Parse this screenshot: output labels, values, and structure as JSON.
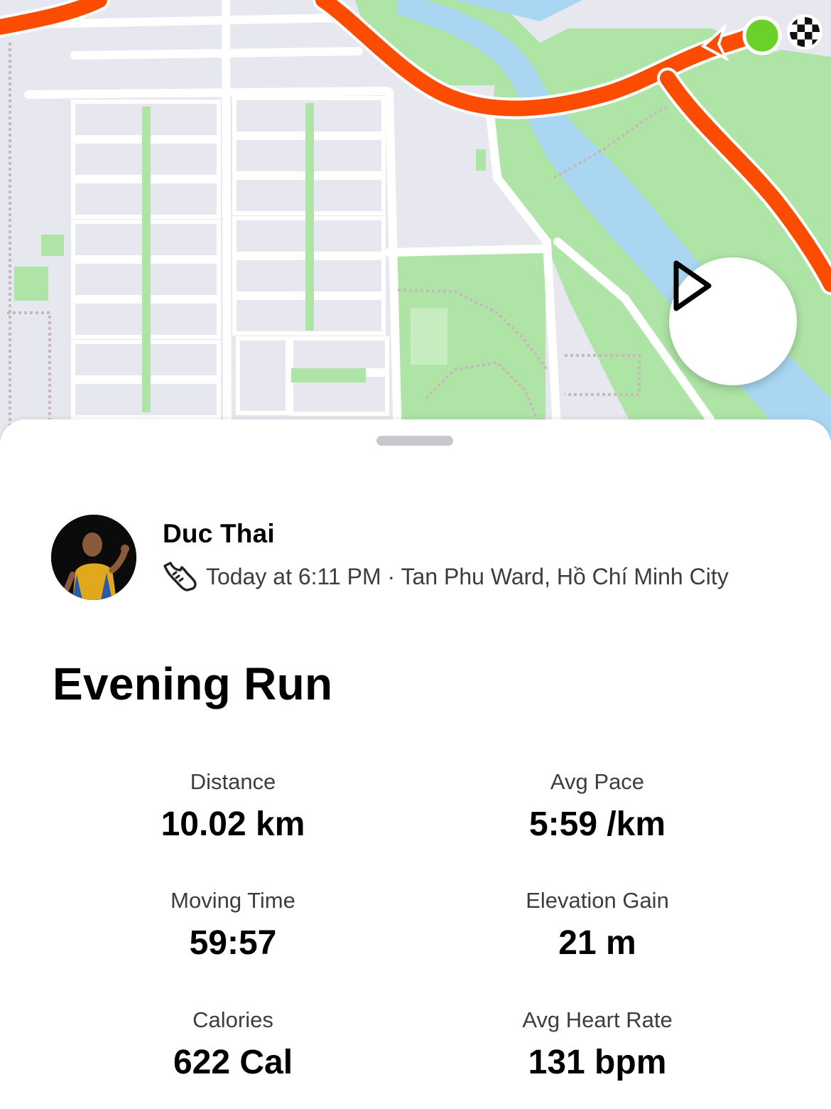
{
  "map": {
    "route_color": "#fc4c02",
    "start_marker_color": "#6ad12a",
    "park_color": "#aee5a6",
    "river_color": "#a9d7f2",
    "land_color": "#e7e7ef",
    "replay_icon": "play-icon"
  },
  "activity": {
    "athlete_name": "Duc Thai",
    "sport_icon": "running-shoe-icon",
    "meta": "Today at 6:11 PM · Tan Phu Ward, Hồ Chí Minh City",
    "title": "Evening Run"
  },
  "stats": [
    {
      "label": "Distance",
      "value": "10.02 km"
    },
    {
      "label": "Avg Pace",
      "value": "5:59 /km"
    },
    {
      "label": "Moving Time",
      "value": "59:57"
    },
    {
      "label": "Elevation Gain",
      "value": "21 m"
    },
    {
      "label": "Calories",
      "value": "622 Cal"
    },
    {
      "label": "Avg Heart Rate",
      "value": "131 bpm"
    }
  ]
}
